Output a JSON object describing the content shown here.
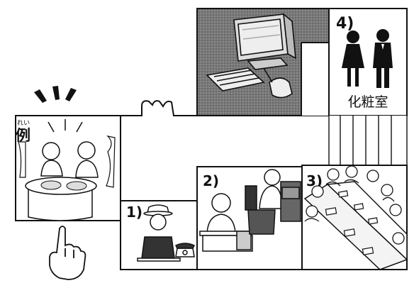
{
  "example": {
    "ruby": "れい",
    "word": "例"
  },
  "rooms": [
    {
      "number": "1)"
    },
    {
      "number": "2)"
    },
    {
      "number": "3)"
    },
    {
      "number": "4)"
    }
  ],
  "restroom": {
    "sign": "化粧室"
  },
  "icons": [
    "hand-pointing-icon",
    "computer-icon",
    "telephone-icon",
    "female-icon",
    "male-icon"
  ]
}
